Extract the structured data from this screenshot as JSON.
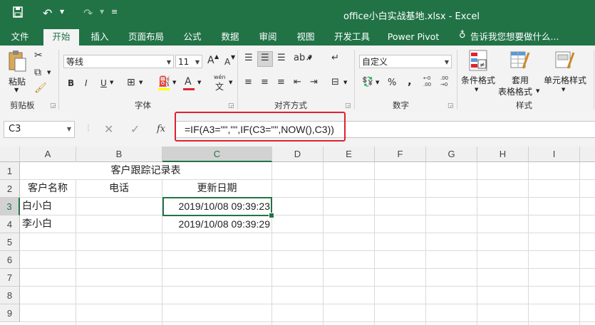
{
  "window": {
    "title": "office小白实战基地.xlsx - Excel"
  },
  "quick_access": {
    "save_icon": "save-icon",
    "undo_icon": "undo-icon",
    "redo_icon": "redo-icon",
    "customize_icon": "customize-icon"
  },
  "tabs": [
    {
      "label": "文件"
    },
    {
      "label": "开始"
    },
    {
      "label": "插入"
    },
    {
      "label": "页面布局"
    },
    {
      "label": "公式"
    },
    {
      "label": "数据"
    },
    {
      "label": "审阅"
    },
    {
      "label": "视图"
    },
    {
      "label": "开发工具"
    },
    {
      "label": "Power Pivot"
    }
  ],
  "tell_me": {
    "placeholder": "告诉我您想要做什么..."
  },
  "ribbon": {
    "clipboard": {
      "paste_label": "粘贴",
      "group_label": "剪贴板"
    },
    "font": {
      "font_name": "等线",
      "font_size": "11",
      "grow": "A",
      "shrink": "A",
      "bold": "B",
      "italic": "I",
      "underline": "U",
      "color_a": "A",
      "wen": "wén",
      "wen_char": "文",
      "group_label": "字体"
    },
    "alignment": {
      "group_label": "对齐方式"
    },
    "number": {
      "format": "自定义",
      "percent": "%",
      "comma": ",",
      "group_label": "数字"
    },
    "styles": {
      "conditional": "条件格式",
      "table_1": "套用",
      "table_2": "表格格式",
      "cell_styles": "单元格样式",
      "group_label": "样式"
    }
  },
  "formula_bar": {
    "name_box": "C3",
    "fx": "fx",
    "formula": "=IF(A3=\"\",\"\",IF(C3=\"\",NOW(),C3))"
  },
  "sheet": {
    "columns": [
      "A",
      "B",
      "C",
      "D",
      "E",
      "F",
      "G",
      "H",
      "I"
    ],
    "rows": [
      "1",
      "2",
      "3",
      "4",
      "5",
      "6",
      "7",
      "8",
      "9"
    ],
    "title": "客户跟踪记录表",
    "headers": [
      "客户名称",
      "电话",
      "更新日期"
    ],
    "data": [
      {
        "name": "白小白",
        "phone": "",
        "date": "2019/10/08 09:39:23"
      },
      {
        "name": "李小白",
        "phone": "",
        "date": "2019/10/08 09:39:29"
      }
    ],
    "selected_cell": "C3"
  },
  "colors": {
    "excel_green": "#217346",
    "highlight_red": "#e0212f"
  }
}
